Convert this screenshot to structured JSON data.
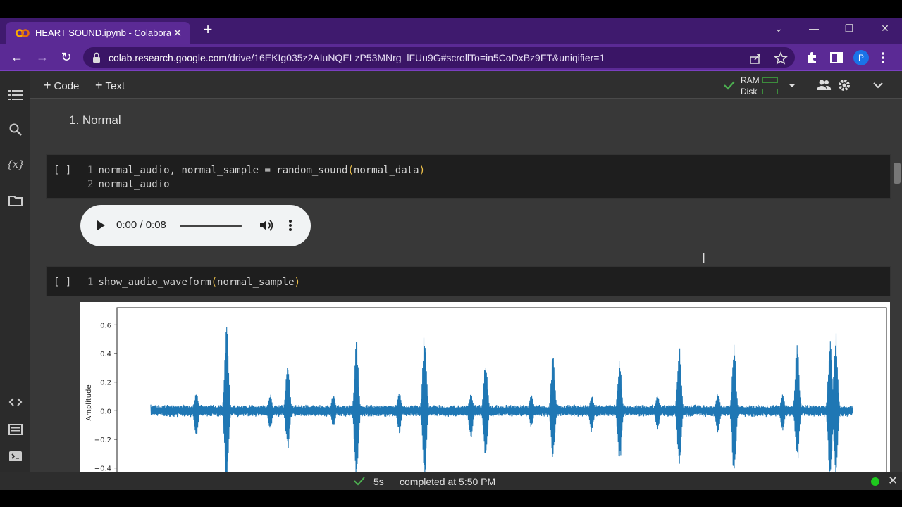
{
  "browser": {
    "tab_title": "HEART SOUND.ipynb - Colaborat",
    "url_host": "colab.research.google.com",
    "url_path": "/drive/16EKIg035z2AIuNQELzP53MNrg_lFUu9G#scrollTo=in5CoDxBz9FT&uniqifier=1",
    "profile_initial": "P",
    "accent_color": "#5b2a95"
  },
  "toolbar": {
    "code_label": "Code",
    "text_label": "Text",
    "ram_label": "RAM",
    "disk_label": "Disk"
  },
  "notebook": {
    "section_title": "1. Normal",
    "cell1": {
      "bracket": "[ ]",
      "line1_num": "1",
      "line1_pre": "normal_audio, normal_sample = random_sound",
      "line1_open": "(",
      "line1_arg": "normal_data",
      "line1_close": ")",
      "line2_num": "2",
      "line2": "normal_audio"
    },
    "audio_player": {
      "time": "0:00 / 0:08"
    },
    "cell2": {
      "bracket": "[ ]",
      "line1_num": "1",
      "line1_pre": "show_audio_waveform",
      "line1_open": "(",
      "line1_arg": "normal_sample",
      "line1_close": ")"
    }
  },
  "chart_data": {
    "type": "line",
    "title": "",
    "xlabel": "",
    "ylabel": "Amplitude",
    "y_ticks": [
      "0.6",
      "0.4",
      "0.2",
      "0.0",
      "−0.2",
      "−0.4"
    ],
    "ylim": [
      -0.52,
      0.72
    ],
    "series_color": "#1f77b4",
    "baseline_noise_amplitude": 0.04,
    "peaks": [
      {
        "x": 0.065,
        "up": 0.13,
        "down": -0.18
      },
      {
        "x": 0.064,
        "up": 0.11,
        "down": -0.14
      },
      {
        "x": 0.108,
        "up": 0.65,
        "down": -0.55
      },
      {
        "x": 0.17,
        "up": 0.12,
        "down": -0.14
      },
      {
        "x": 0.195,
        "up": 0.38,
        "down": -0.28
      },
      {
        "x": 0.26,
        "up": 0.12,
        "down": -0.12
      },
      {
        "x": 0.293,
        "up": 0.5,
        "down": -0.52
      },
      {
        "x": 0.354,
        "up": 0.14,
        "down": -0.16
      },
      {
        "x": 0.39,
        "up": 0.59,
        "down": -0.48
      },
      {
        "x": 0.456,
        "up": 0.12,
        "down": -0.2
      },
      {
        "x": 0.477,
        "up": 0.37,
        "down": -0.34
      },
      {
        "x": 0.542,
        "up": 0.13,
        "down": -0.12
      },
      {
        "x": 0.573,
        "up": 0.4,
        "down": -0.35
      },
      {
        "x": 0.628,
        "up": 0.11,
        "down": -0.16
      },
      {
        "x": 0.668,
        "up": 0.37,
        "down": -0.38
      },
      {
        "x": 0.722,
        "up": 0.12,
        "down": -0.14
      },
      {
        "x": 0.753,
        "up": 0.5,
        "down": -0.4
      },
      {
        "x": 0.808,
        "up": 0.12,
        "down": -0.18
      },
      {
        "x": 0.831,
        "up": 0.47,
        "down": -0.46
      },
      {
        "x": 0.9,
        "up": 0.12,
        "down": -0.14
      },
      {
        "x": 0.921,
        "up": 0.5,
        "down": -0.38
      },
      {
        "x": 0.968,
        "up": 0.54,
        "down": -0.52
      },
      {
        "x": 0.976,
        "up": 0.56,
        "down": -0.5
      }
    ]
  },
  "status": {
    "duration": "5s",
    "message": "completed at 5:50 PM"
  }
}
